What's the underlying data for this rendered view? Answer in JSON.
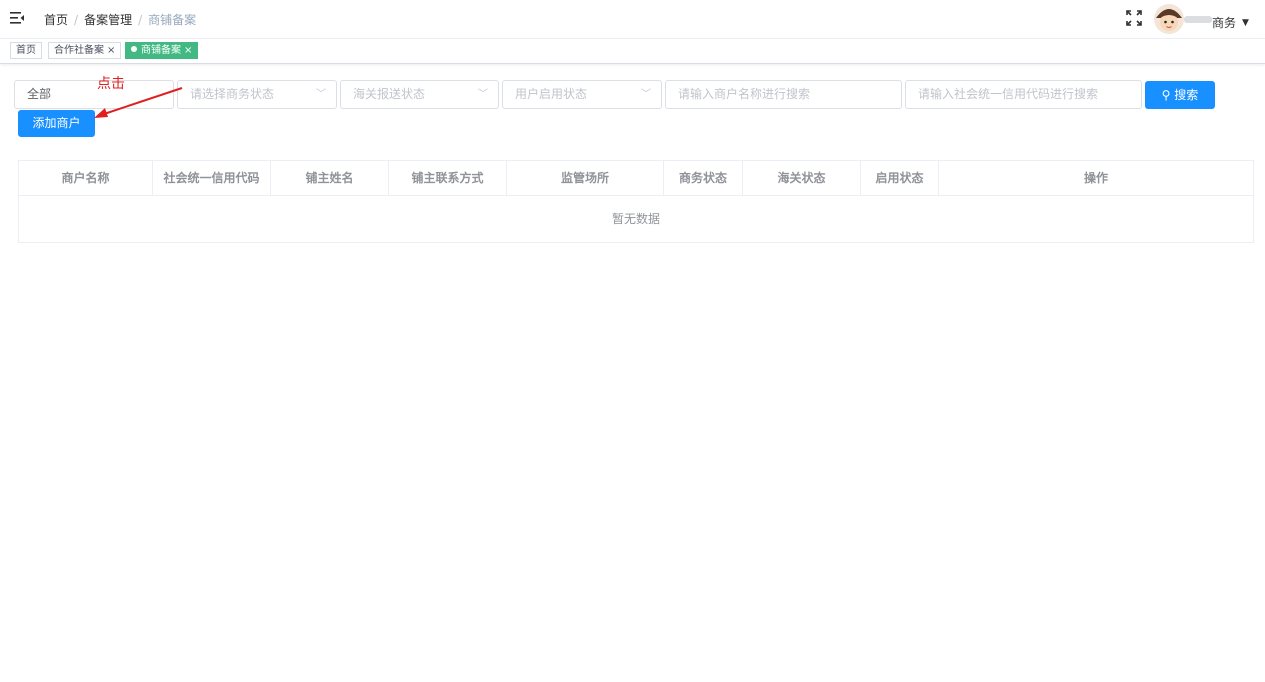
{
  "breadcrumb": [
    "首页",
    "备案管理",
    "商铺备案"
  ],
  "user": {
    "name": "商务"
  },
  "tags": [
    {
      "label": "首页",
      "active": false
    },
    {
      "label": "合作社备案",
      "active": false,
      "closable": true
    },
    {
      "label": "商铺备案",
      "active": true,
      "closable": true
    }
  ],
  "filters": {
    "scope_value": "全部",
    "business_status_placeholder": "请选择商务状态",
    "customs_status_placeholder": "海关报送状态",
    "user_enable_placeholder": "用户启用状态",
    "merchant_name_placeholder": "请输入商户名称进行搜索",
    "credit_code_placeholder": "请输入社会统一信用代码进行搜索",
    "search_label": "搜索"
  },
  "add_button_label": "添加商户",
  "annotation": {
    "text": "点击",
    "color": "#e02020"
  },
  "table": {
    "columns": [
      "商户名称",
      "社会统一信用代码",
      "铺主姓名",
      "铺主联系方式",
      "监管场所",
      "商务状态",
      "海关状态",
      "启用状态",
      "操作"
    ],
    "empty_text": "暂无数据"
  },
  "colors": {
    "primary": "#1890ff",
    "tag_active": "#42b983"
  },
  "icons": [
    "hamburger-icon",
    "fullscreen-icon",
    "search-icon",
    "chevron-down-icon",
    "close-icon"
  ]
}
